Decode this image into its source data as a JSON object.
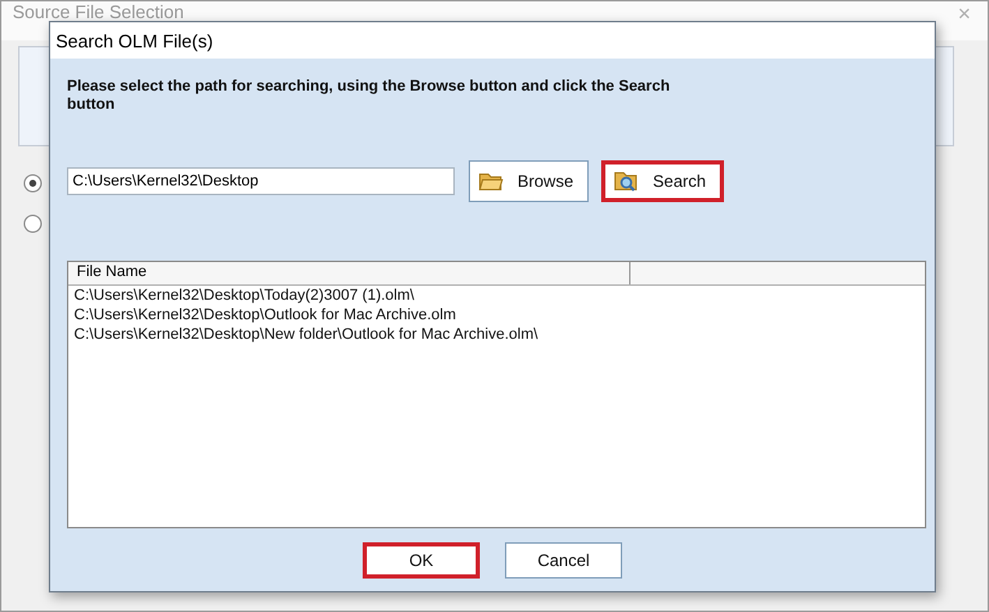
{
  "background_window": {
    "title": "Source File Selection",
    "close": "×",
    "options": [
      {
        "selected": true
      },
      {
        "selected": false
      }
    ]
  },
  "dialog": {
    "title": "Search OLM File(s)",
    "instruction": "Please select the path for searching, using the Browse button and click the Search button",
    "path": "C:\\Users\\Kernel32\\Desktop",
    "buttons": [
      {
        "label": "Browse",
        "kind": "browse",
        "highlighted": false
      },
      {
        "label": "Search",
        "kind": "search",
        "highlighted": true
      }
    ],
    "table": {
      "columns": [
        "File Name"
      ],
      "rows": [
        "C:\\Users\\Kernel32\\Desktop\\Today(2)3007 (1).olm\\",
        "C:\\Users\\Kernel32\\Desktop\\Outlook for Mac Archive.olm",
        "C:\\Users\\Kernel32\\Desktop\\New folder\\Outlook for Mac Archive.olm\\"
      ]
    },
    "footer_buttons": [
      {
        "label": "OK",
        "highlighted": true
      },
      {
        "label": "Cancel",
        "highlighted": false
      }
    ]
  }
}
